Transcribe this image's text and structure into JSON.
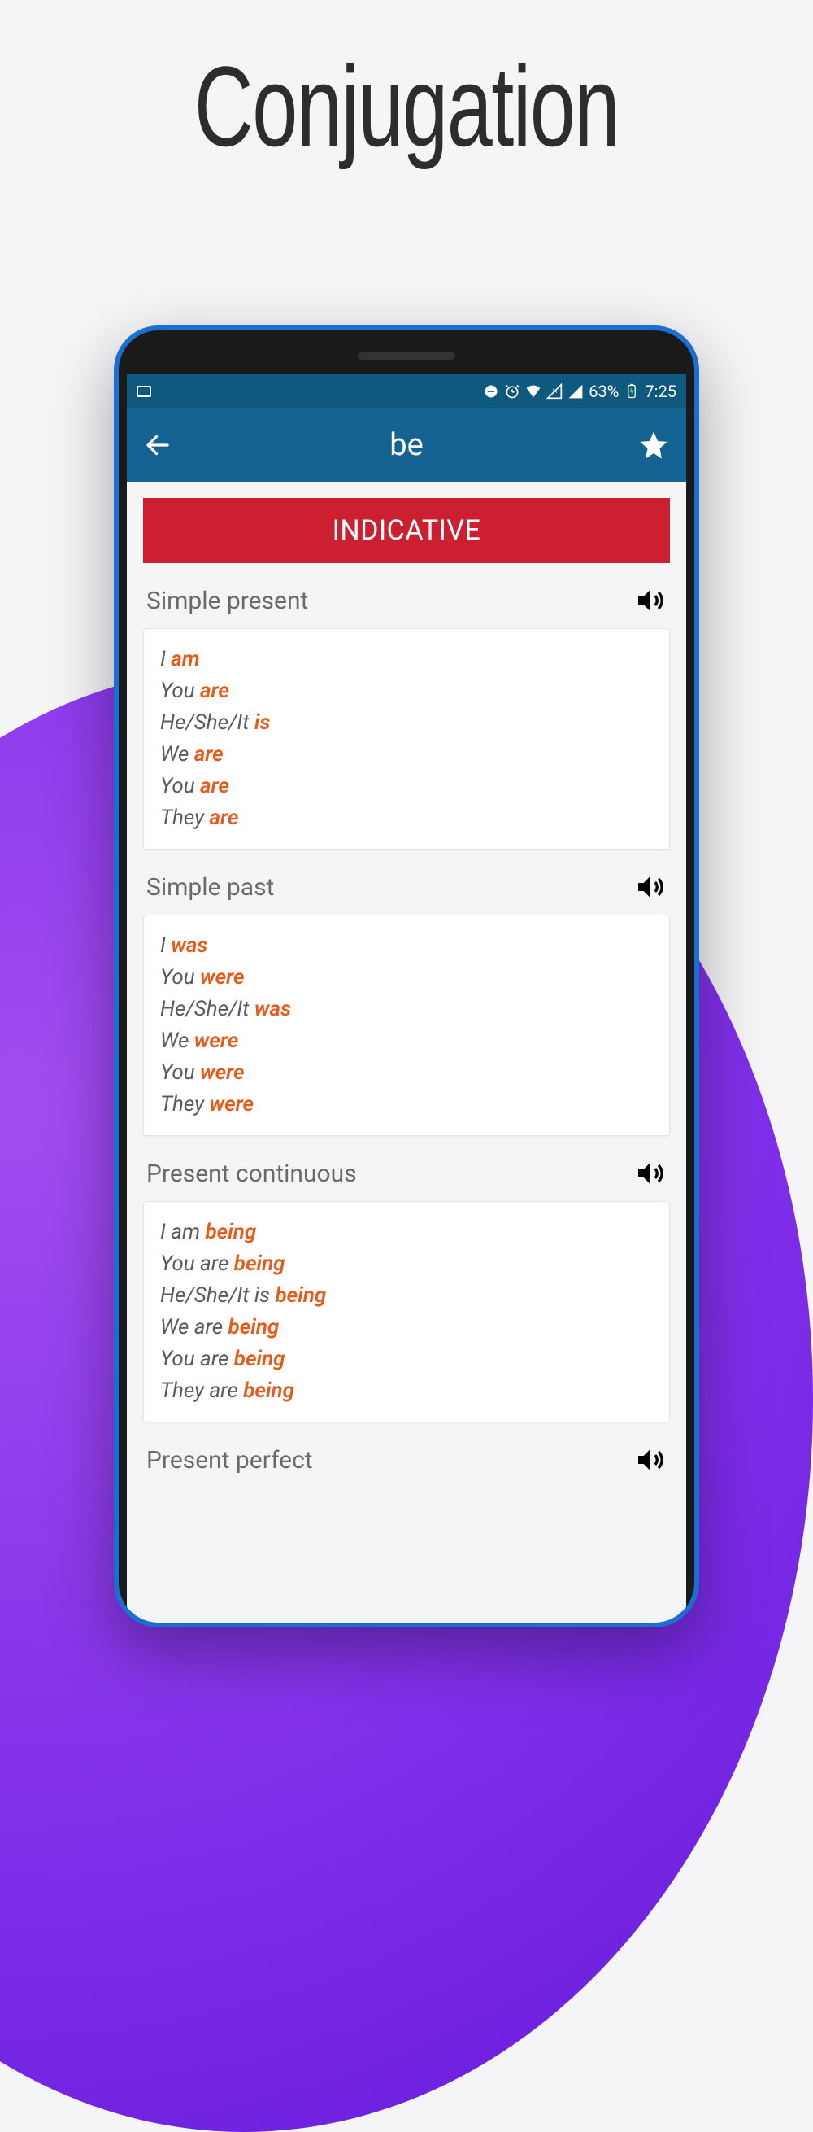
{
  "pageTitle": "Conjugation",
  "statusBar": {
    "battery": "63%",
    "time": "7:25"
  },
  "appBar": {
    "title": "be"
  },
  "mood": "INDICATIVE",
  "tenses": [
    {
      "title": "Simple present",
      "rows": [
        {
          "pronoun": "I",
          "verb": "am"
        },
        {
          "pronoun": "You",
          "verb": "are"
        },
        {
          "pronoun": "He/She/It",
          "verb": "is"
        },
        {
          "pronoun": "We",
          "verb": "are"
        },
        {
          "pronoun": "You",
          "verb": "are"
        },
        {
          "pronoun": "They",
          "verb": "are"
        }
      ]
    },
    {
      "title": "Simple past",
      "rows": [
        {
          "pronoun": "I",
          "verb": "was"
        },
        {
          "pronoun": "You",
          "verb": "were"
        },
        {
          "pronoun": "He/She/It",
          "verb": "was"
        },
        {
          "pronoun": "We",
          "verb": "were"
        },
        {
          "pronoun": "You",
          "verb": "were"
        },
        {
          "pronoun": "They",
          "verb": "were"
        }
      ]
    },
    {
      "title": "Present continuous",
      "rows": [
        {
          "pronoun": "I am",
          "verb": "being"
        },
        {
          "pronoun": "You are",
          "verb": "being"
        },
        {
          "pronoun": "He/She/It is",
          "verb": "being"
        },
        {
          "pronoun": "We are",
          "verb": "being"
        },
        {
          "pronoun": "You are",
          "verb": "being"
        },
        {
          "pronoun": "They are",
          "verb": "being"
        }
      ]
    },
    {
      "title": "Present perfect",
      "rows": []
    }
  ]
}
